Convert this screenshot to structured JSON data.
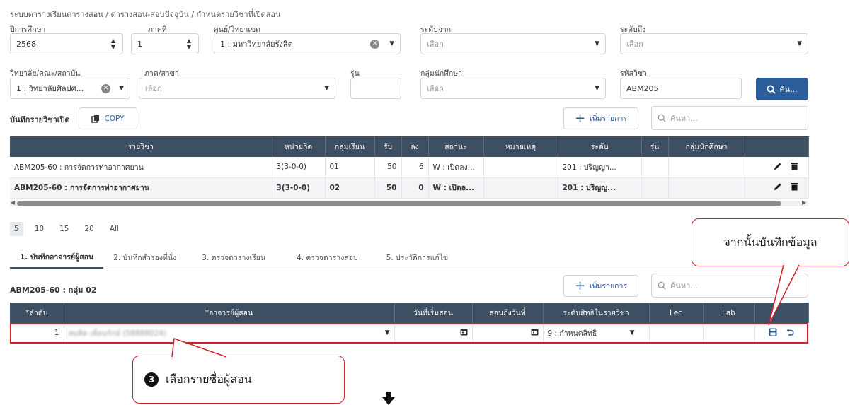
{
  "breadcrumb": "ระบบตารางเรียนตารางสอน  /  ตารางสอน-สอบปัจจุบัน / กำหนดรายวิชาที่เปิดสอน",
  "filters": {
    "year_label": "ปีการศึกษา",
    "year_value": "2568",
    "term_label": "ภาคที่",
    "term_value": "1",
    "campus_label": "ศูนย์/วิทยาเขต",
    "campus_value": "1 : มหาวิทยาลัยรังสิต",
    "level_from_label": "ระดับจาก",
    "level_from_placeholder": "เลือก",
    "level_to_label": "ระดับถึง",
    "level_to_placeholder": "เลือก",
    "faculty_label": "วิทยาลัย/คณะ/สถาบัน",
    "faculty_value": "1 : วิทยาลัยศิลปศ...",
    "dept_label": "ภาค/สาขา",
    "dept_placeholder": "เลือก",
    "batch_label": "รุ่น",
    "group_label": "กลุ่มนักศึกษา",
    "group_placeholder": "เลือก",
    "course_code_label": "รหัสวิชา",
    "course_code_value": "ABM205",
    "search_button": "ค้น..."
  },
  "course_section": {
    "title": "บันทึกรายวิชาเปิด",
    "copy_button": "COPY",
    "add_button": "เพิ่มรายการ",
    "search_placeholder": "ค้นหา...",
    "columns": [
      "รายวิชา",
      "หน่วยกิต",
      "กลุ่มเรียน",
      "รับ",
      "ลง",
      "สถานะ",
      "หมายเหตุ",
      "ระดับ",
      "รุ่น",
      "กลุ่มนักศึกษา",
      ""
    ],
    "rows": [
      {
        "course": "ABM205-60 : การจัดการท่าอากาศยาน",
        "credit": "3(3-0-0)",
        "section": "01",
        "accept": "50",
        "enrolled": "6",
        "status": "W : เปิดลง...",
        "note": "",
        "level": "201 : ปริญญา...",
        "batch": "",
        "group": ""
      },
      {
        "course": "ABM205-60 : การจัดการท่าอากาศยาน",
        "credit": "3(3-0-0)",
        "section": "02",
        "accept": "50",
        "enrolled": "0",
        "status": "W : เปิดล...",
        "note": "",
        "level": "201 : ปริญญ...",
        "batch": "",
        "group": ""
      }
    ]
  },
  "pager": {
    "sizes": [
      "5",
      "10",
      "15",
      "20",
      "All"
    ]
  },
  "tabs": [
    "1. บันทึกอาจารย์ผู้สอน",
    "2. บันทึกสำรองที่นั่ง",
    "3. ตรวจตารางเรียน",
    "4. ตรวจตารางสอบ",
    "5. ประวัติการแก้ไข"
  ],
  "teacher_section": {
    "title": "ABM205-60 : กลุ่ม 02",
    "add_button": "เพิ่มรายการ",
    "search_placeholder": "ค้นหา...",
    "columns": [
      "*ลำดับ",
      "*อาจารย์ผู้สอน",
      "วันที่เริ่มสอน",
      "สอนถึงวันที่",
      "ระดับสิทธิในรายวิชา",
      "Lec",
      "Lab",
      ""
    ],
    "row": {
      "order": "1",
      "teacher": "สมคิด เพื่อนรักษ์ (58888024)",
      "right_level": "9 : กำหนดสิทธิ"
    }
  },
  "callouts": {
    "save_note": "จากนั้นบันทึกข้อมูล",
    "step_number": "3",
    "select_note": "เลือกรายชื่อผู้สอน"
  },
  "colors": {
    "header": "#3d4f63",
    "accent": "#2b5d9a",
    "highlight": "#d0202a"
  }
}
